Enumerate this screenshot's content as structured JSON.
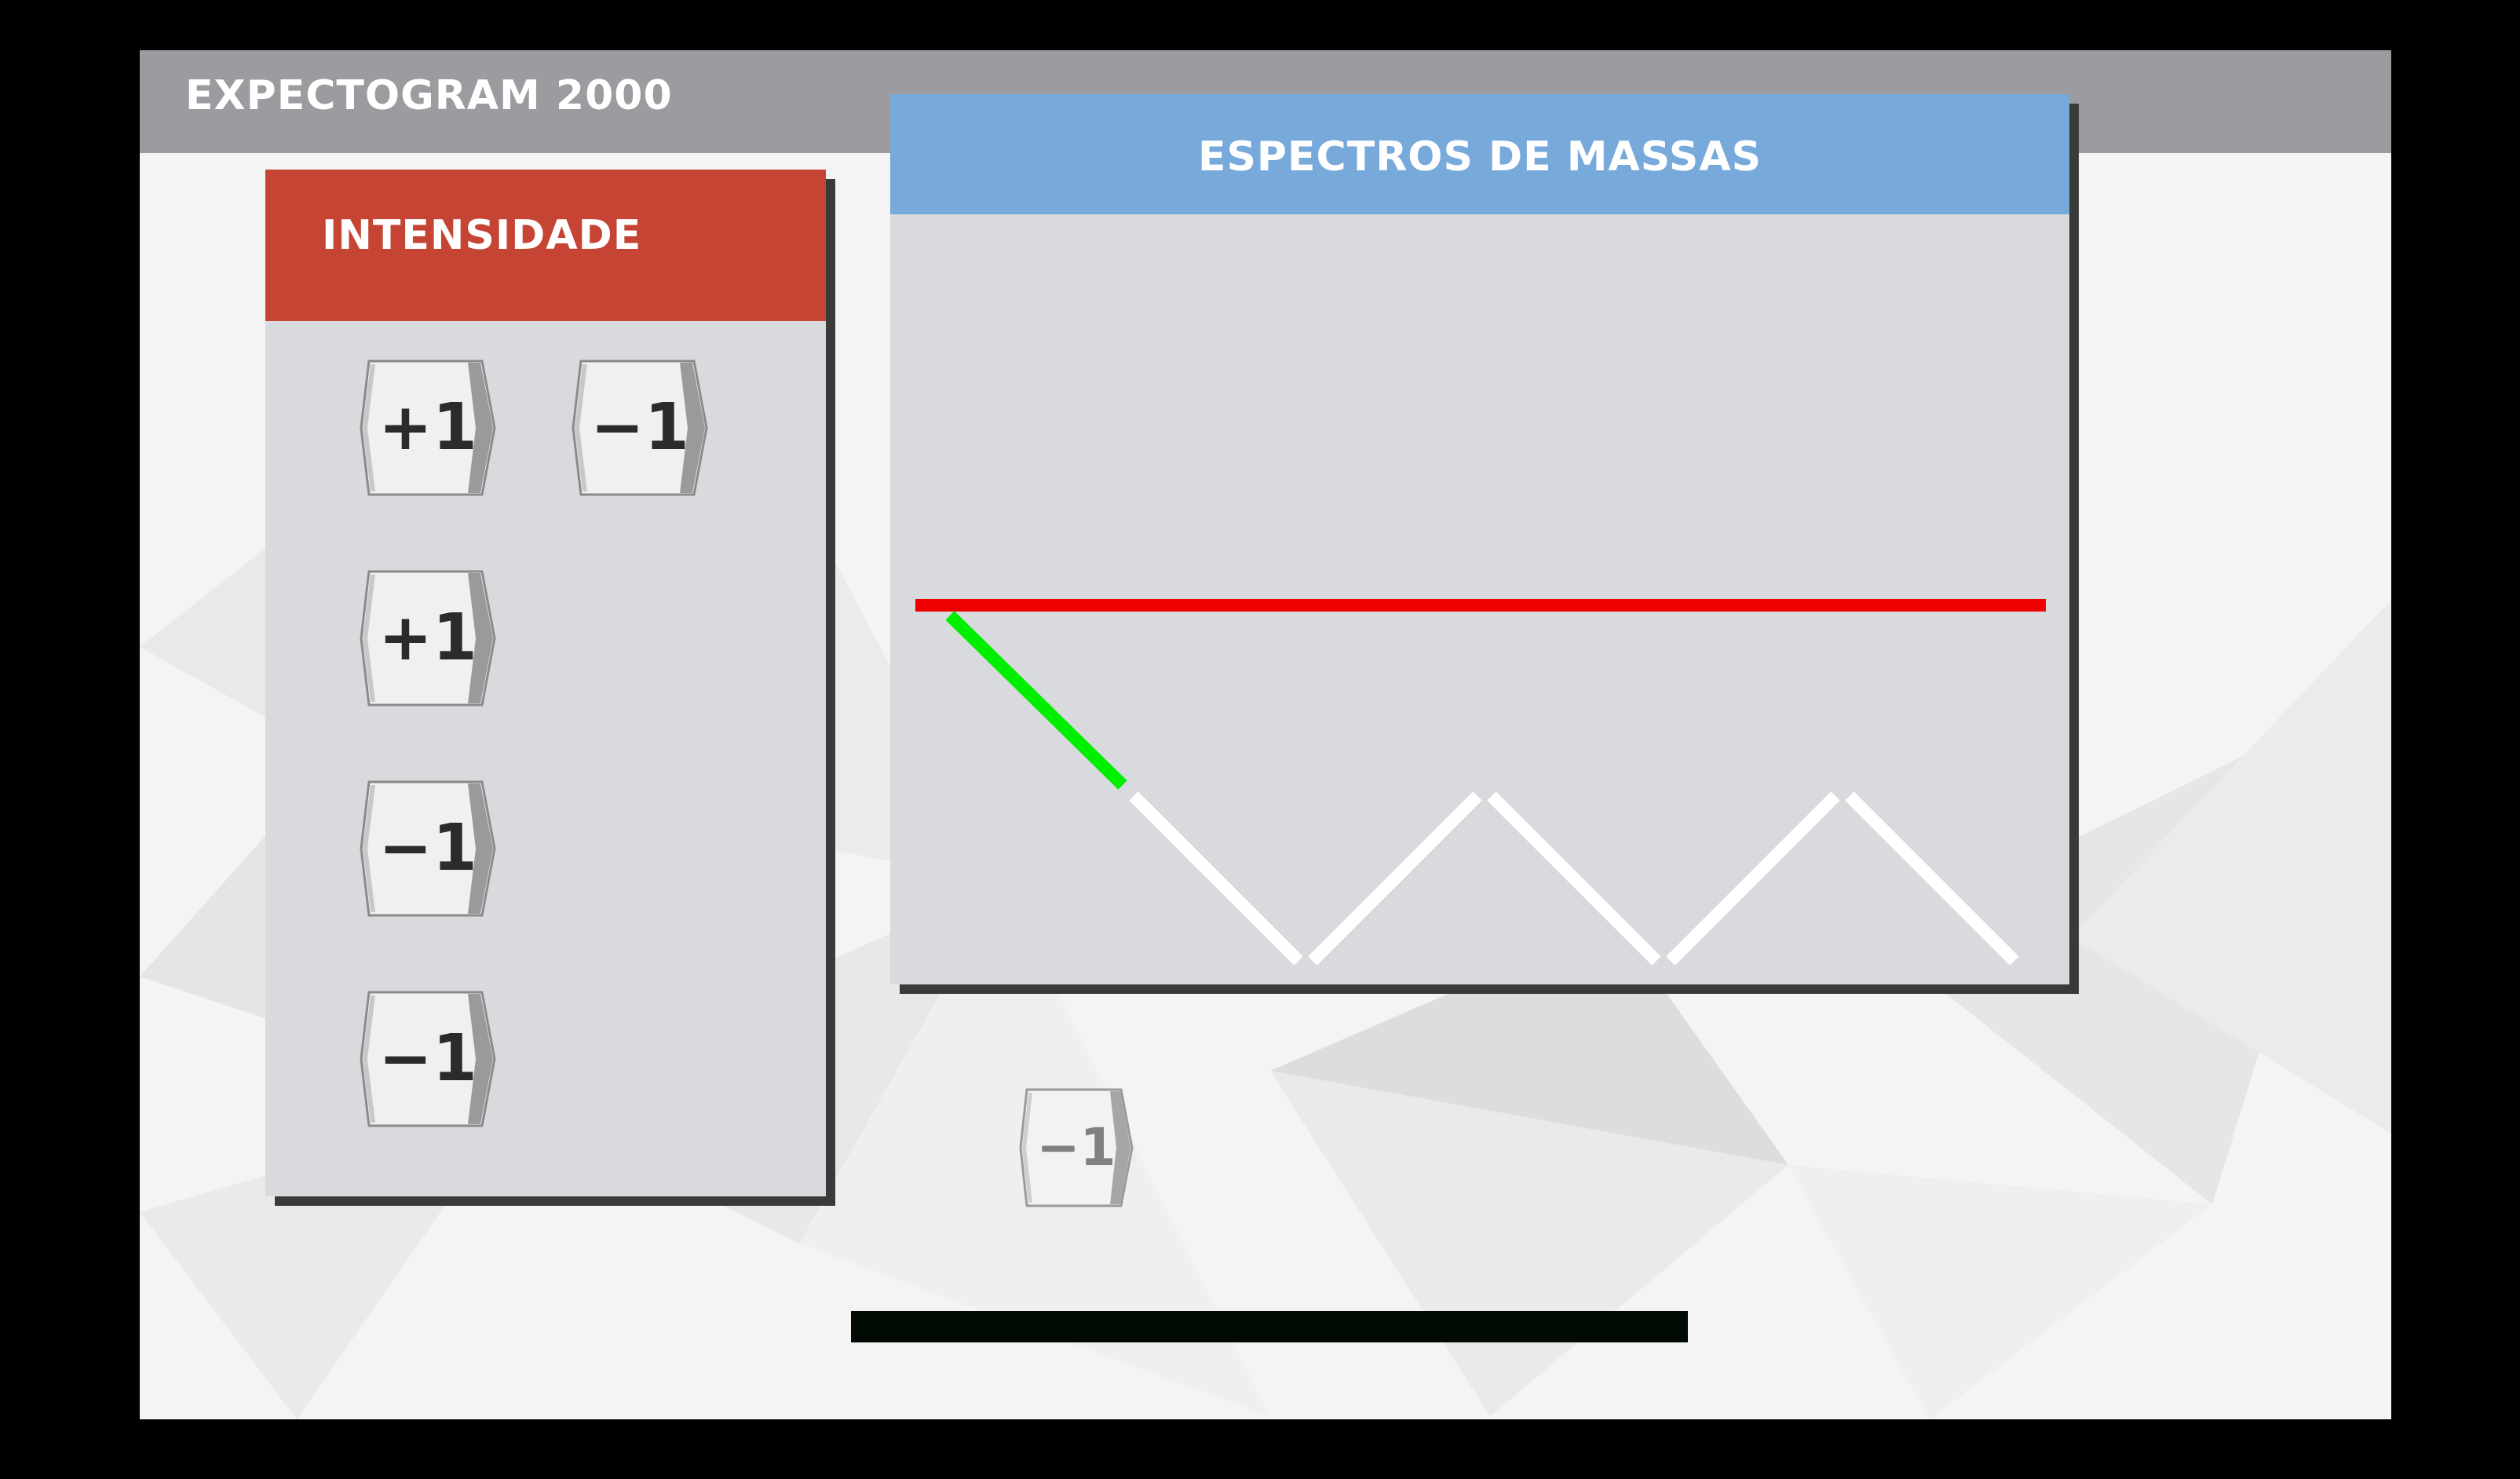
{
  "app": {
    "title": "EXPECTOGRAM 2000"
  },
  "intensity_panel": {
    "title": "INTENSIDADE",
    "tiles": [
      {
        "label": "+1"
      },
      {
        "label": "−1"
      },
      {
        "label": "+1"
      },
      {
        "label": "−1"
      },
      {
        "label": "−1"
      }
    ]
  },
  "spectra_panel": {
    "title": "ESPECTROS DE MASSAS"
  },
  "loose_tile": {
    "label": "−1"
  },
  "colors": {
    "header": "#9b9ba0",
    "intensity_header": "#c64434",
    "spectra_header": "#77aadb",
    "panel_body": "#d9dadd",
    "baseline": "#ee0000",
    "path_done": "#00ee00",
    "path_pending": "#ffffff"
  }
}
